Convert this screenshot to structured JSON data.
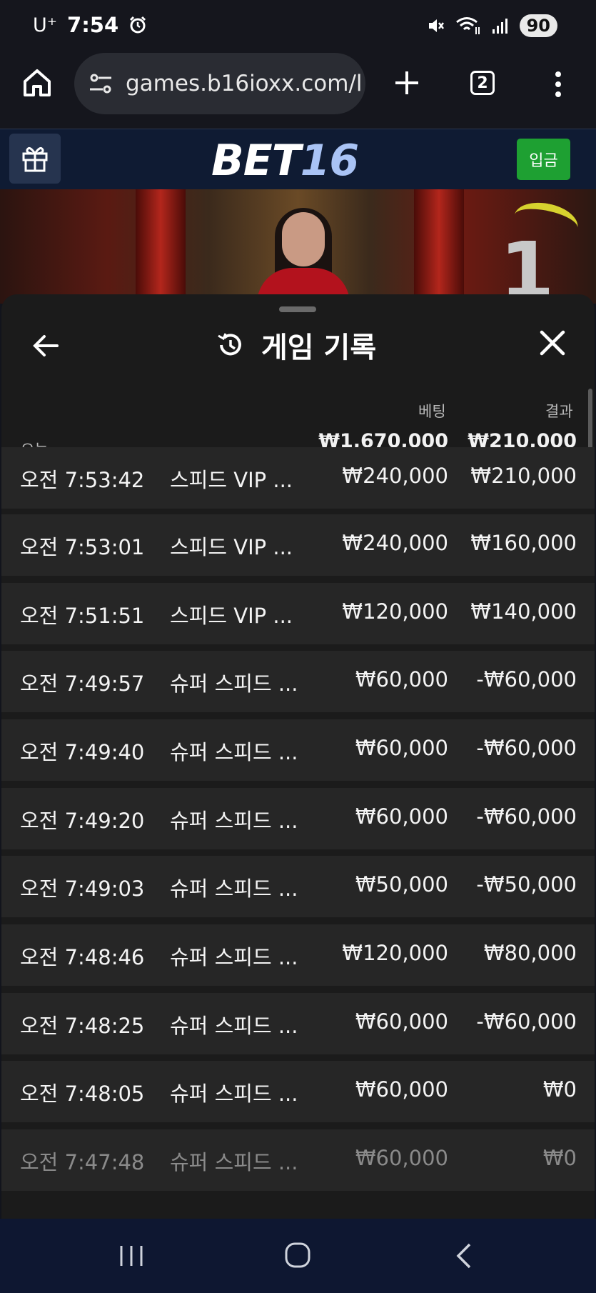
{
  "status_bar": {
    "carrier": "U⁺",
    "time": "7:54",
    "battery": "90",
    "icons": [
      "alarm-icon",
      "mute-icon",
      "wifi-icon",
      "signal-icon"
    ]
  },
  "browser": {
    "url": "games.b16ioxx.com/l",
    "tab_count": "2",
    "icons": [
      "home-icon",
      "site-settings-icon",
      "new-tab-icon",
      "tabs-icon",
      "more-menu-icon"
    ]
  },
  "site": {
    "logo_part1": "BET",
    "logo_part2": "16",
    "deposit_label": "입금",
    "colors": {
      "header_bg": "#0f1b33",
      "deposit_green": "#1ea032",
      "logo_accent": "#a9c3f5"
    }
  },
  "video": {
    "number_shown": "1"
  },
  "sheet": {
    "title": "게임 기록",
    "bet_column_label": "베팅",
    "result_column_label": "결과",
    "today_label": "오늘",
    "total_bet": "₩1,670,000",
    "total_result": "₩210,000",
    "rows": [
      {
        "time": "오전 7:53:42",
        "game": "스피드 VIP ...",
        "bet": "₩240,000",
        "result": "₩210,000"
      },
      {
        "time": "오전 7:53:01",
        "game": "스피드 VIP ...",
        "bet": "₩240,000",
        "result": "₩160,000"
      },
      {
        "time": "오전 7:51:51",
        "game": "스피드 VIP ...",
        "bet": "₩120,000",
        "result": "₩140,000"
      },
      {
        "time": "오전 7:49:57",
        "game": "슈퍼 스피드 ...",
        "bet": "₩60,000",
        "result": "-₩60,000"
      },
      {
        "time": "오전 7:49:40",
        "game": "슈퍼 스피드 ...",
        "bet": "₩60,000",
        "result": "-₩60,000"
      },
      {
        "time": "오전 7:49:20",
        "game": "슈퍼 스피드 ...",
        "bet": "₩60,000",
        "result": "-₩60,000"
      },
      {
        "time": "오전 7:49:03",
        "game": "슈퍼 스피드 ...",
        "bet": "₩50,000",
        "result": "-₩50,000"
      },
      {
        "time": "오전 7:48:46",
        "game": "슈퍼 스피드 ...",
        "bet": "₩120,000",
        "result": "₩80,000"
      },
      {
        "time": "오전 7:48:25",
        "game": "슈퍼 스피드 ...",
        "bet": "₩60,000",
        "result": "-₩60,000"
      },
      {
        "time": "오전 7:48:05",
        "game": "슈퍼 스피드 ...",
        "bet": "₩60,000",
        "result": "₩0"
      },
      {
        "time": "오전 7:47:48",
        "game": "슈퍼 스피드 ...",
        "bet": "₩60,000",
        "result": "₩0"
      }
    ]
  },
  "nav_bar": {
    "icons": [
      "recent-apps-icon",
      "home-circle-icon",
      "back-chevron-icon"
    ]
  }
}
